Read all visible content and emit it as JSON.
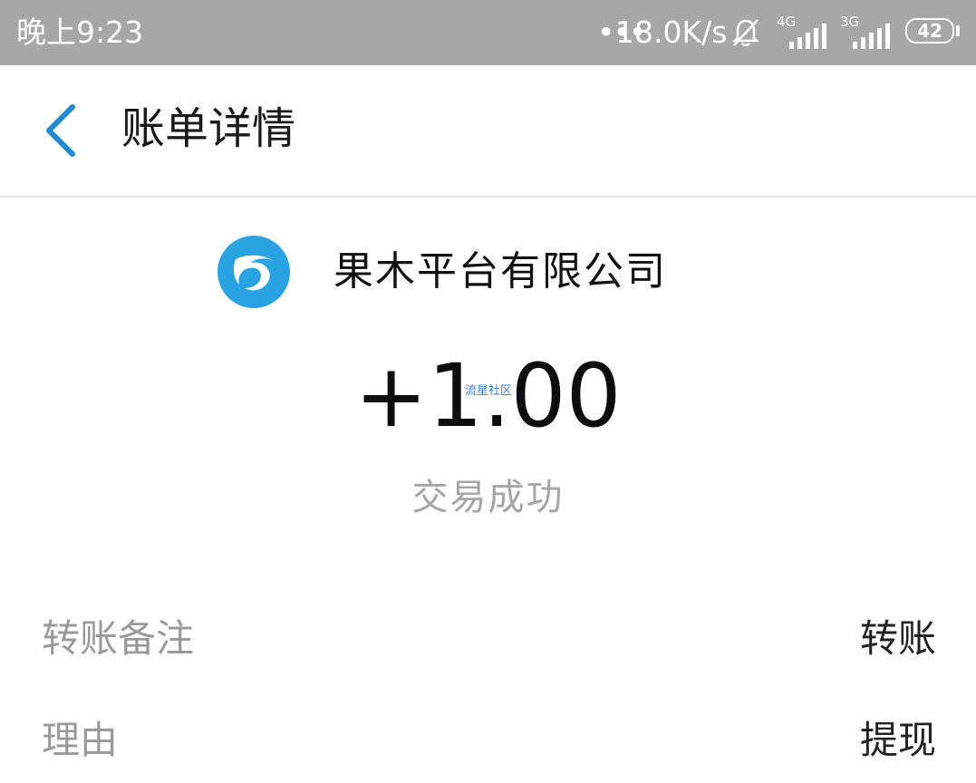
{
  "status_bar": {
    "time": "晚上9:23",
    "network_dots": "•••",
    "network_speed": "18.0K/s",
    "signal1_label": "4G",
    "signal2_label": "3G",
    "battery": "42"
  },
  "header": {
    "title": "账单详情"
  },
  "merchant": {
    "name": "果木平台有限公司",
    "logo_color": "#2aa3e2"
  },
  "transaction": {
    "amount": "+1.00",
    "watermark": "流星社区",
    "status": "交易成功"
  },
  "details": [
    {
      "label": "转账备注",
      "value": "转账"
    },
    {
      "label": "理由",
      "value": "提现"
    }
  ],
  "colors": {
    "accent": "#1f8ad2",
    "status_bar_bg": "#a7a7a7"
  }
}
